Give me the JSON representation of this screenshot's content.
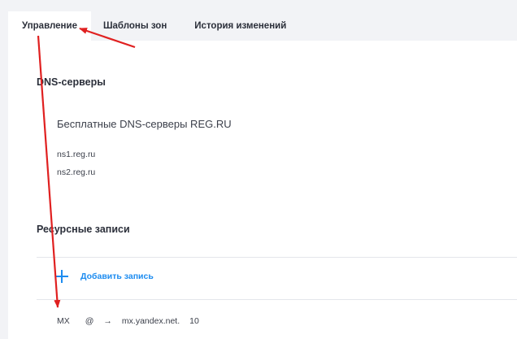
{
  "tabs": [
    {
      "label": "Управление",
      "active": true
    },
    {
      "label": "Шаблоны зон",
      "active": false
    },
    {
      "label": "История изменений",
      "active": false
    }
  ],
  "dns": {
    "title": "DNS-серверы",
    "provider": "Бесплатные DNS-серверы REG.RU",
    "servers": [
      "ns1.reg.ru",
      "ns2.reg.ru"
    ]
  },
  "records": {
    "title": "Ресурсные записи",
    "add_label": "Добавить запись",
    "rows": [
      {
        "type": "MX",
        "host": "@",
        "arrow": "→",
        "value": "mx.yandex.net.",
        "priority": "10"
      }
    ]
  },
  "colors": {
    "accent": "#1d8cf0",
    "annotation": "#e02020",
    "background": "#f2f3f6"
  },
  "icons": {
    "add": "plus-icon",
    "annotation": "arrow-annotation-icon"
  }
}
